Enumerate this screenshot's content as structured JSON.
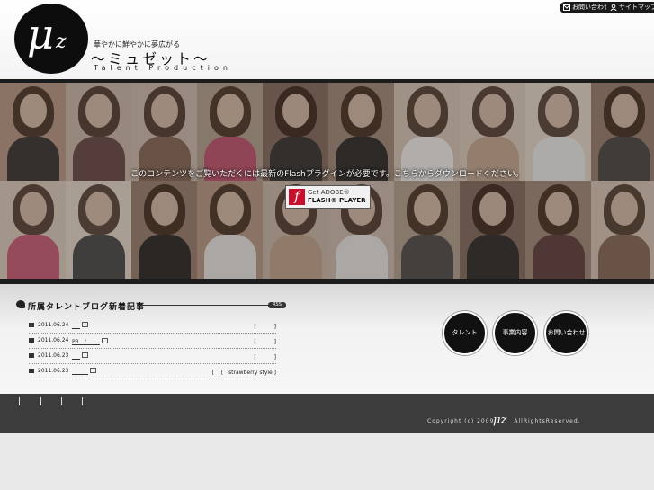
{
  "header": {
    "logo_mu": "μ",
    "logo_z": "z",
    "tagline": "華やかに鮮やかに夢広がる",
    "brand": "〜ミュゼット〜",
    "brand_sub": "Talent Production",
    "contact_label": "お問い合わせ",
    "sitemap_label": "サイトマップ"
  },
  "hero": {
    "flash_message": "このコンテンツをご覧いただくには最新のFlashプラグインが必要です。こちらからダウンロードください。",
    "badge_glyph": "f",
    "badge_line1": "Get ADOBE®",
    "badge_line2": "FLASH® PLAYER"
  },
  "blog": {
    "title": "所属タレントブログ新着記事",
    "rss": "RSS",
    "posts": [
      {
        "date": "2011.06.24",
        "title": "___",
        "name": "[　　　 ]"
      },
      {
        "date": "2011.06.24",
        "title": "PR　/　___",
        "name": "[　　　 ]"
      },
      {
        "date": "2011.06.23",
        "title": "___",
        "name": "[　　　 ]"
      },
      {
        "date": "2011.06.23",
        "title": "______",
        "name": "[　 [　strawberry style ]"
      }
    ]
  },
  "nav": {
    "talent": "タレント",
    "business": "事業内容",
    "contact": "お問い合わせ"
  },
  "footer": {
    "copyright": "Copyright (c) 2009",
    "copyright_tail": "AllRightsReserved.",
    "logo": "μz"
  },
  "colors": {
    "dark": "#1a1a1a",
    "footer": "#3c3c3c",
    "flash_red": "#c8102e"
  }
}
